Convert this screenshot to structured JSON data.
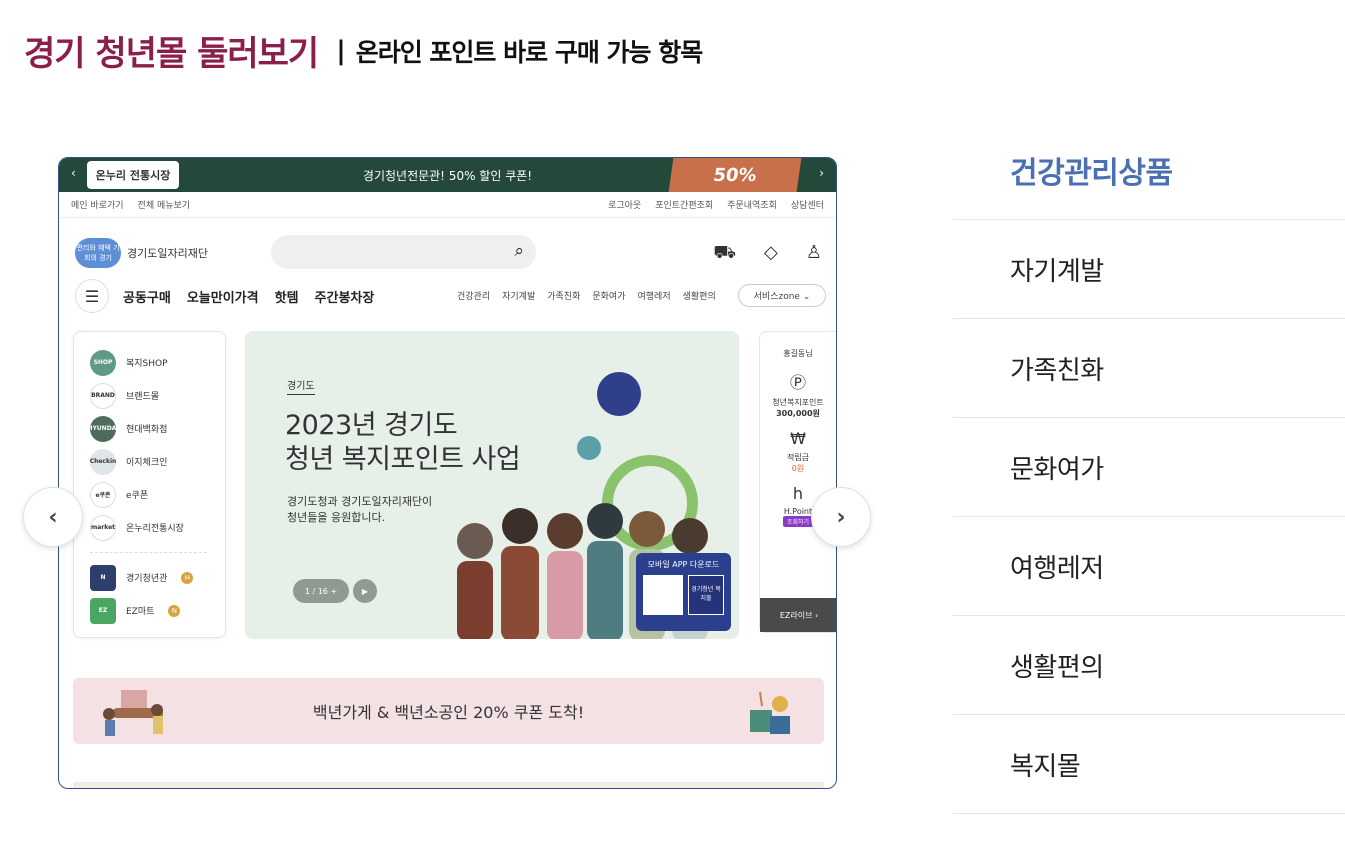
{
  "heading": {
    "title": "경기 청년몰 둘러보기",
    "separator": "|",
    "subtitle": "온라인 포인트 바로 구매 가능 항목"
  },
  "screenshot": {
    "promo_bar": {
      "left_arrow": "‹",
      "logo_text": "온누리 전통시장",
      "text": "경기청년전문관! 50% 할인 쿠폰!",
      "coupon_text": "50%",
      "right_arrow": "›"
    },
    "util_nav": {
      "left": [
        "메인 바로가기",
        "전체 메뉴보기"
      ],
      "right": [
        "로그아웃",
        "포인트간편조회",
        "주문내역조회",
        "상담센터"
      ]
    },
    "header": {
      "brand_badge": "편리와 혜택 기회의 경기",
      "brand_name": "경기도일자리재단",
      "search_icon": "⌕",
      "icons": [
        "truck-icon",
        "bag-icon",
        "user-icon"
      ]
    },
    "nav": {
      "menu_icon": "☰",
      "main": [
        "공동구매",
        "오늘만이가격",
        "핫템",
        "주간봉차장"
      ],
      "categories": [
        "건강관리",
        "자기계발",
        "가족친화",
        "문화여가",
        "여행레저",
        "생활편의"
      ],
      "zone": "서비스zone ⌄"
    },
    "side_menu": {
      "items": [
        {
          "icon": "SHOP",
          "label": "복지SHOP",
          "color": "#5e9a86"
        },
        {
          "icon": "BRAND",
          "label": "브랜드몰",
          "color": "#ffffff"
        },
        {
          "icon": "HYUNDAI",
          "label": "현대백화점",
          "color": "#4f6b5e"
        },
        {
          "icon": "Checkin",
          "label": "이지체크인",
          "color": "#dfe6e8"
        },
        {
          "icon": "e쿠폰",
          "label": "e쿠폰",
          "color": "#ffffff"
        },
        {
          "icon": "market",
          "label": "온누리전통시장",
          "color": "#ffffff"
        }
      ],
      "bottom_items": [
        {
          "icon": "N",
          "label": "경기청년관",
          "badge": "H",
          "color": "#2e3f6e"
        },
        {
          "icon": "EZ",
          "label": "EZ마트",
          "badge": "N",
          "color": "#4aa660"
        }
      ]
    },
    "banner": {
      "tag": "경기도",
      "title_line1": "2023년 경기도",
      "title_line2": "청년 복지포인트 사업",
      "desc_line1": "경기도청과 경기도일자리재단이",
      "desc_line2": "청년들을 응원합니다.",
      "pager": "1 / 16 +",
      "play": "▶",
      "app_title": "모바일 APP 다운로드",
      "app_logo": "경기청년 복지몰"
    },
    "profile": {
      "name": "홍길동님",
      "point_label": "청년복지포인트",
      "point_value": "300,000원",
      "reserve_label": "적립금",
      "reserve_value": "0원",
      "hpoint_label": "H.Point",
      "hpoint_btn": "조회하기",
      "footer": "EZ라이브 ›"
    },
    "strip": {
      "text": "백년가게 & 백년소공인 20% 쿠폰 도착!"
    }
  },
  "carousel": {
    "prev": "‹",
    "next": "›"
  },
  "categories": [
    {
      "label": "건강관리상품",
      "active": true
    },
    {
      "label": "자기계발",
      "active": false
    },
    {
      "label": "가족친화",
      "active": false
    },
    {
      "label": "문화여가",
      "active": false
    },
    {
      "label": "여행레저",
      "active": false
    },
    {
      "label": "생활편의",
      "active": false
    },
    {
      "label": "복지몰",
      "active": false
    }
  ],
  "colors": {
    "heading": "#8b1f4b",
    "active_category": "#4a6fb2",
    "promo_bg": "#24493b",
    "banner_bg": "#e6efe8",
    "strip_bg": "#f3e1e3"
  }
}
